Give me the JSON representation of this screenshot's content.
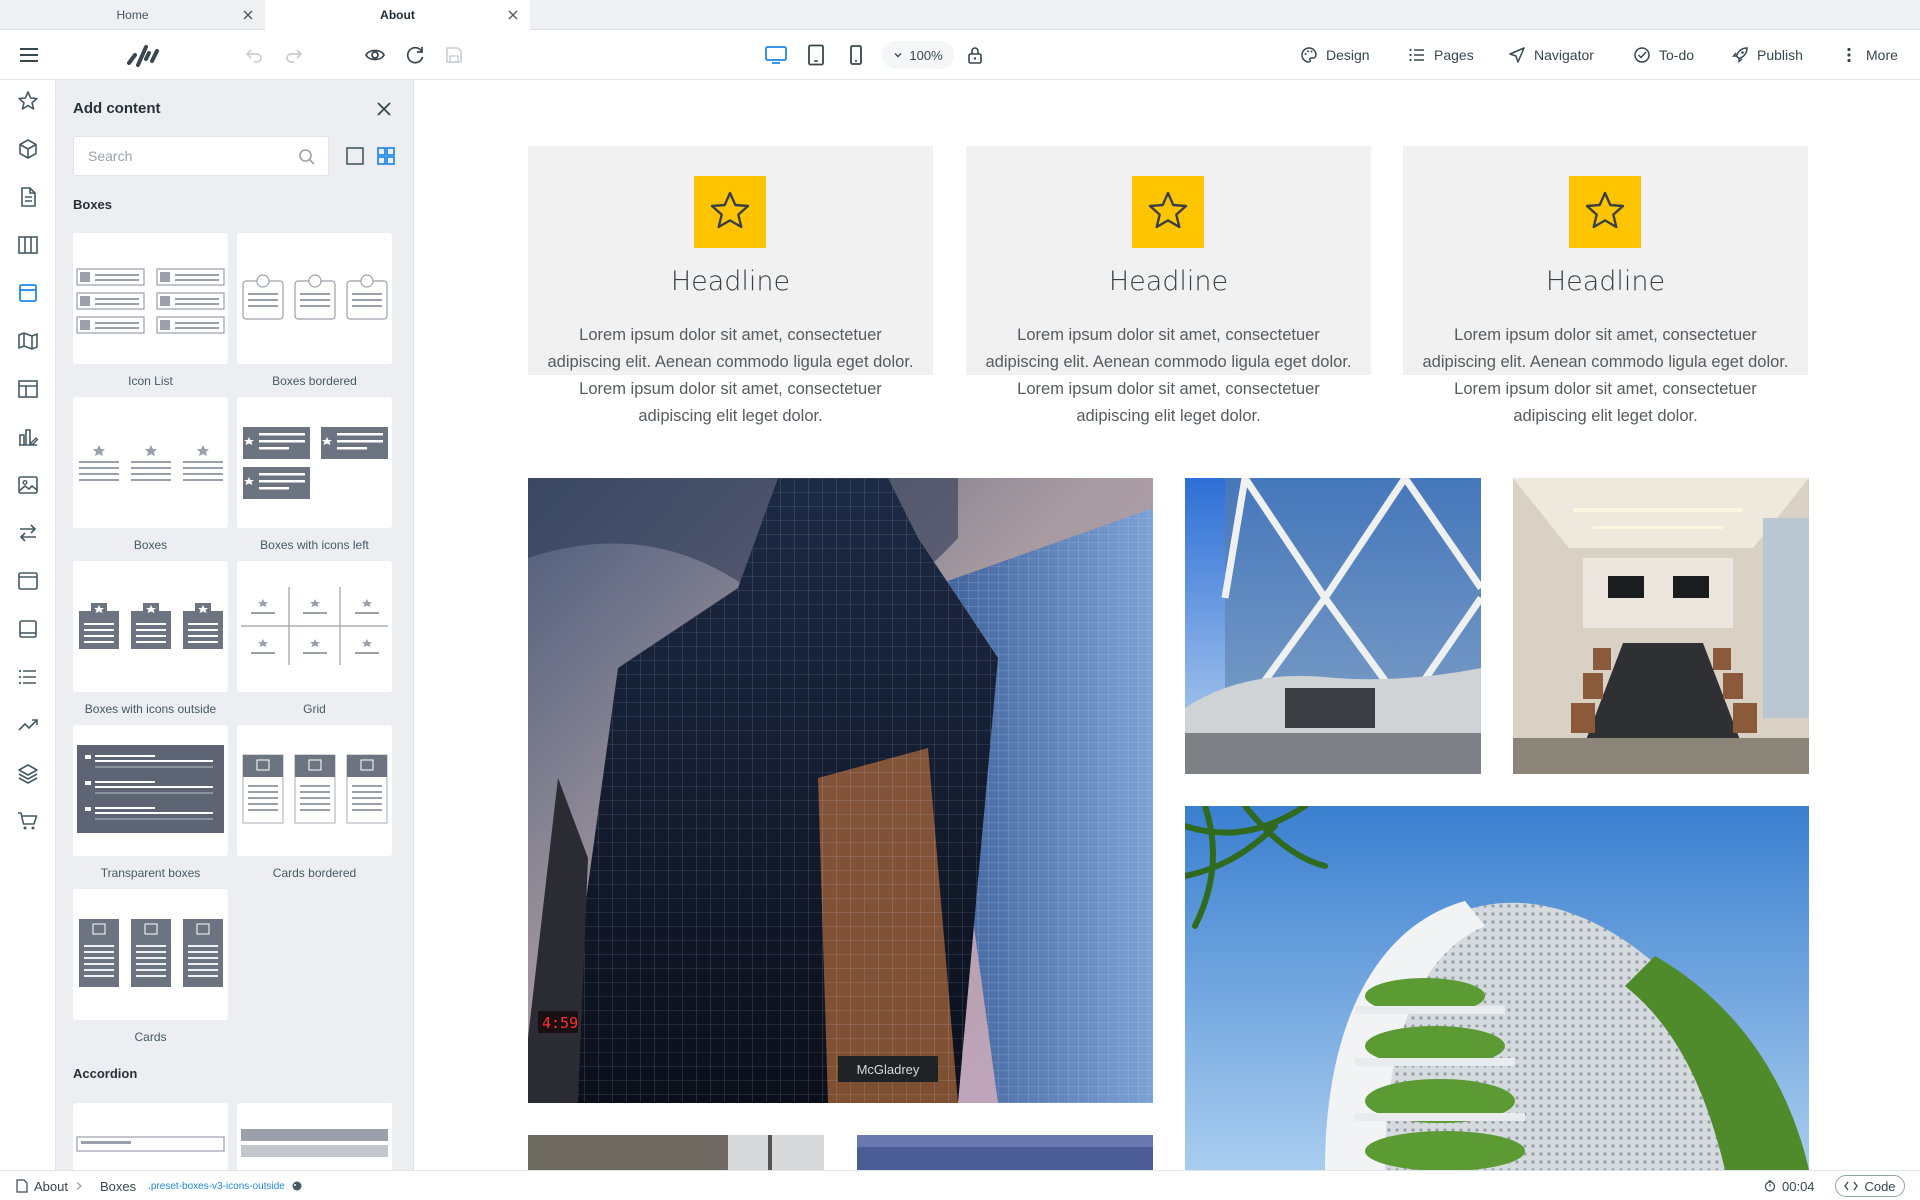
{
  "tabs": [
    {
      "label": "Home",
      "active": false
    },
    {
      "label": "About",
      "active": true
    }
  ],
  "toolbar": {
    "zoom": "100%",
    "design": "Design",
    "pages": "Pages",
    "navigator": "Navigator",
    "todo": "To-do",
    "publish": "Publish",
    "more": "More"
  },
  "rail_icons": [
    "star-icon",
    "cube-icon",
    "document-icon",
    "columns-icon",
    "box-icon",
    "map-icon",
    "layout-icon",
    "chart-edit-icon",
    "image-icon",
    "swap-icon",
    "window-icon",
    "tablet-icon",
    "list-icon",
    "trend-icon",
    "layers-icon",
    "cart-icon"
  ],
  "panel": {
    "title": "Add content",
    "search_placeholder": "Search",
    "section_boxes": "Boxes",
    "section_accordion": "Accordion",
    "items": [
      {
        "label": "Icon List"
      },
      {
        "label": "Boxes bordered"
      },
      {
        "label": "Boxes"
      },
      {
        "label": "Boxes with icons left"
      },
      {
        "label": "Boxes with icons outside"
      },
      {
        "label": "Grid"
      },
      {
        "label": "Transparent boxes"
      },
      {
        "label": "Cards bordered"
      },
      {
        "label": "Cards"
      }
    ]
  },
  "features": [
    {
      "headline": "Headline",
      "text": "Lorem ipsum dolor sit amet, consectetuer adipiscing elit. Aenean commodo ligula eget dolor. Lorem ipsum dolor sit amet, consectetuer adipiscing elit leget dolor."
    },
    {
      "headline": "Headline",
      "text": "Lorem ipsum dolor sit amet, consectetuer adipiscing elit. Aenean commodo ligula eget dolor. Lorem ipsum dolor sit amet, consectetuer adipiscing elit leget dolor."
    },
    {
      "headline": "Headline",
      "text": "Lorem ipsum dolor sit amet, consectetuer adipiscing elit. Aenean commodo ligula eget dolor. Lorem ipsum dolor sit amet, consectetuer adipiscing elit leget dolor."
    }
  ],
  "photos": {
    "tower_sign": "McGladrey",
    "clock": "4:59"
  },
  "statusbar": {
    "page": "About",
    "element": "Boxes",
    "css_class": ".preset-boxes-v3-icons-outside",
    "time": "00:04",
    "code": "Code"
  },
  "colors": {
    "accent": "#1e88e5",
    "feature_icon_bg": "#ffc400",
    "feature_bg": "#f0f1f0",
    "panel_bg": "#eceef1"
  }
}
